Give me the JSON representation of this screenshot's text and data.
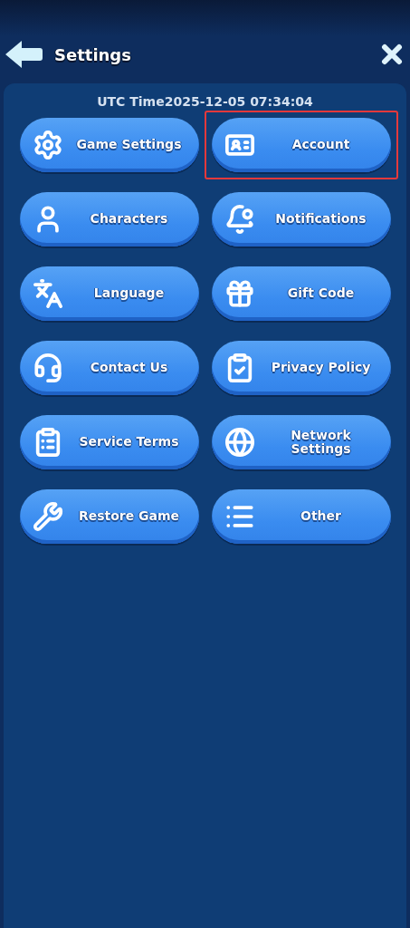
{
  "header": {
    "title": "Settings"
  },
  "utc_time": "UTC Time2025-12-05 07:34:04",
  "buttons": [
    {
      "kind": "gear",
      "label": "Game Settings",
      "highlighted": false
    },
    {
      "kind": "id-card",
      "label": "Account",
      "highlighted": true
    },
    {
      "kind": "person",
      "label": "Characters",
      "highlighted": false
    },
    {
      "kind": "bell",
      "label": "Notifications",
      "highlighted": false
    },
    {
      "kind": "language",
      "label": "Language",
      "highlighted": false
    },
    {
      "kind": "gift",
      "label": "Gift Code",
      "highlighted": false
    },
    {
      "kind": "headset",
      "label": "Contact Us",
      "highlighted": false
    },
    {
      "kind": "clipboard-shield",
      "label": "Privacy Policy",
      "highlighted": false
    },
    {
      "kind": "clipboard-list",
      "label": "Service Terms",
      "highlighted": false
    },
    {
      "kind": "globe",
      "label": "Network Settings",
      "highlighted": false
    },
    {
      "kind": "wrench",
      "label": "Restore Game",
      "highlighted": false
    },
    {
      "kind": "list",
      "label": "Other",
      "highlighted": false
    }
  ]
}
